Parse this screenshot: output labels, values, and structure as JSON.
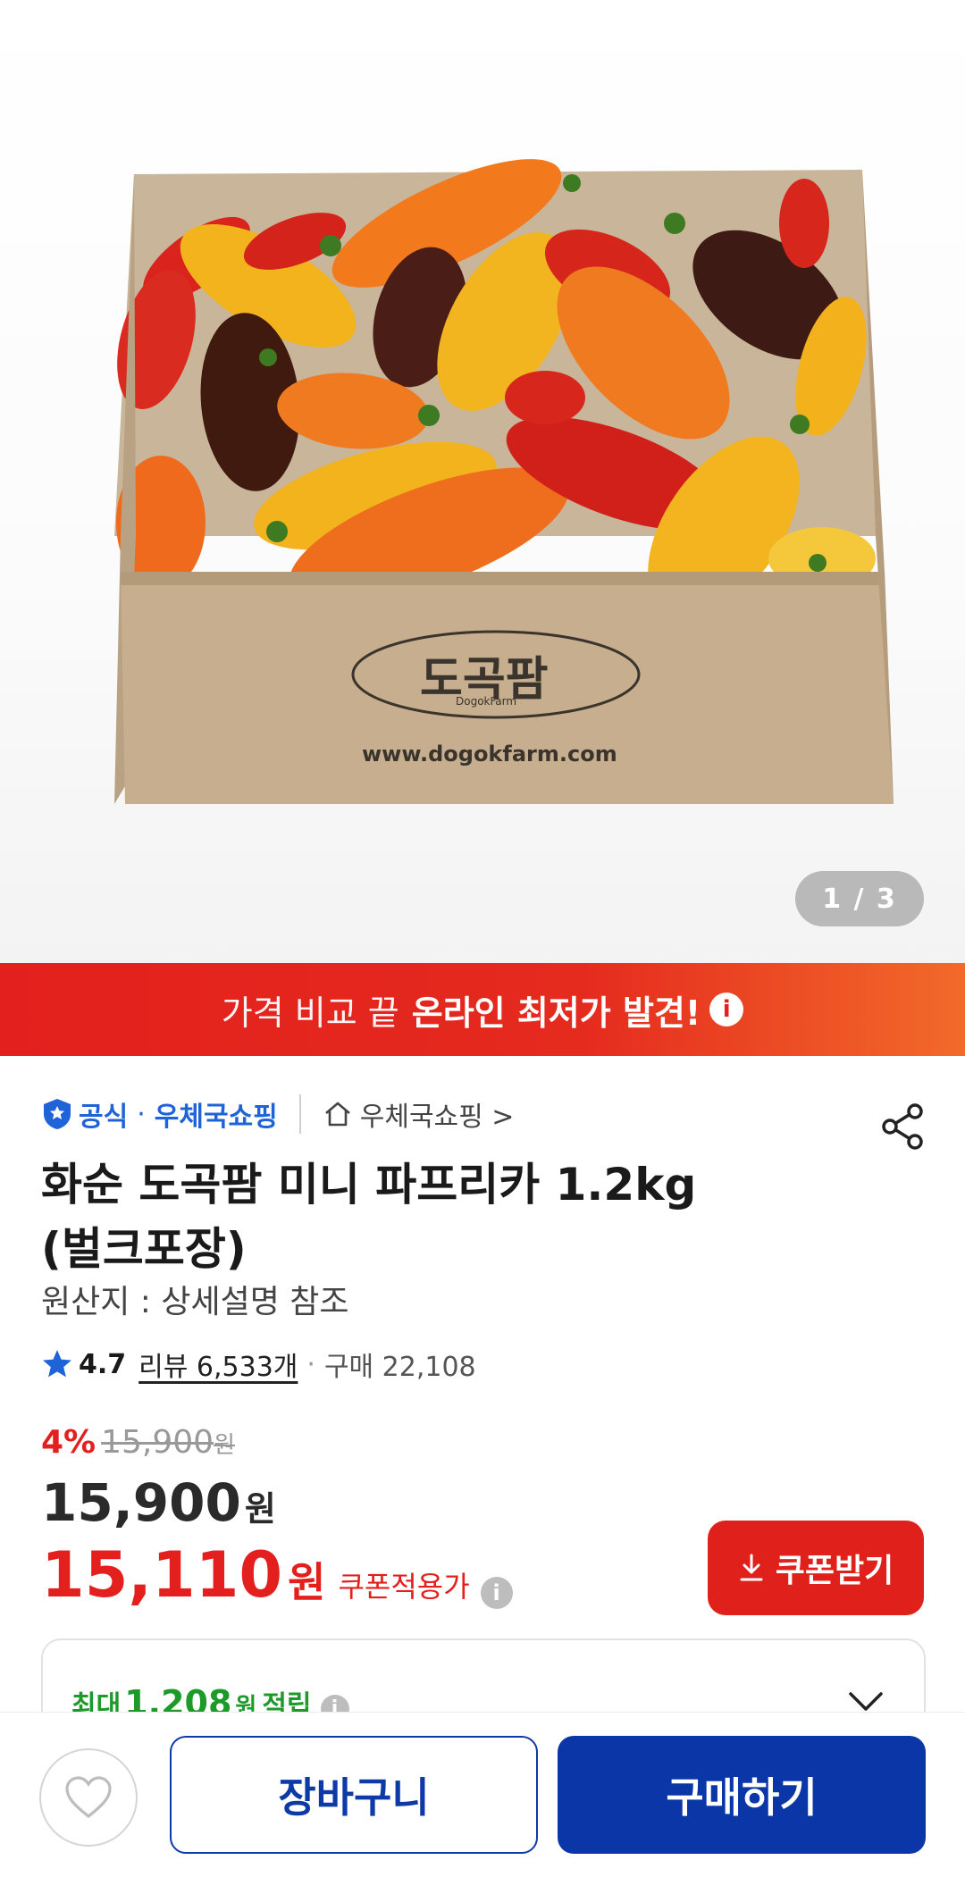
{
  "image": {
    "box_brand": "도곡팜",
    "box_brand_en": "DogokFarm",
    "box_url": "www.dogokfarm.com",
    "counter": "1 / 3"
  },
  "promo": {
    "lead": "가격 비교 끝",
    "highlight": "온라인 최저가 발견!",
    "info_icon": "i"
  },
  "seller": {
    "official_badge": "공식",
    "separator": "·",
    "name": "우체국쇼핑",
    "store_link": "우체국쇼핑 >"
  },
  "product": {
    "title_line1": "화순 도곡팜 미니 파프리카 1.2kg",
    "title_line2": "(벌크포장)",
    "origin": "원산지 : 상세설명 참조",
    "rating": "4.7",
    "reviews": "리뷰 6,533개",
    "purchases": "구매 22,108"
  },
  "price": {
    "discount": "4%",
    "original": "15,900",
    "original_unit": "원",
    "sale": "15,900",
    "sale_unit": "원",
    "coupon_price": "15,110",
    "coupon_unit": "원",
    "coupon_label": "쿠폰적용가",
    "coupon_button": "쿠폰받기"
  },
  "reward": {
    "prefix": "최대",
    "amount": "1,208",
    "unit": "원",
    "suffix": "적립"
  },
  "actions": {
    "cart": "장바구니",
    "buy": "구매하기"
  },
  "colors": {
    "accent_red": "#e3201d",
    "brand_blue": "#0a36a8",
    "reward_green": "#1d9a2a"
  }
}
